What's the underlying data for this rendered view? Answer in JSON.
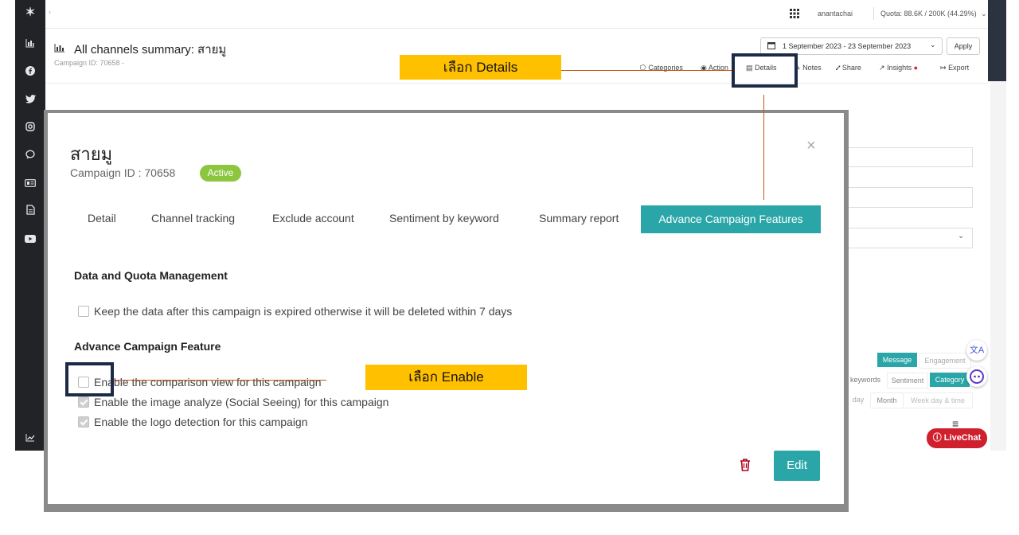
{
  "sidebar": {
    "items": [
      {
        "icon": "logo-icon"
      },
      {
        "icon": "chart-bar-icon"
      },
      {
        "icon": "facebook-icon"
      },
      {
        "icon": "twitter-icon"
      },
      {
        "icon": "instagram-icon"
      },
      {
        "icon": "chat-bubble-icon"
      },
      {
        "icon": "news-icon"
      },
      {
        "icon": "document-icon"
      },
      {
        "icon": "youtube-icon"
      },
      {
        "icon": "trend-icon"
      }
    ]
  },
  "topbar": {
    "username": "anantachai",
    "quota": "Quota: 88.6K / 200K (44.29%)"
  },
  "header": {
    "title": "All channels summary: สายมู",
    "campaign_id": "Campaign ID: 70658 -",
    "date_range": "1 September 2023 - 23 September 2023",
    "apply": "Apply",
    "tools": [
      "Categories",
      "Action",
      "Details",
      "Notes",
      "Share",
      "Insights",
      "Export"
    ]
  },
  "modal": {
    "title": "สายมู",
    "campaign_id": "Campaign ID : 70658",
    "status": "Active",
    "close": "×",
    "tabs": [
      "Detail",
      "Channel tracking",
      "Exclude account",
      "Sentiment by keyword",
      "Summary report",
      "Advance Campaign Features"
    ],
    "section1": "Data and Quota Management",
    "keep_data": "Keep the data after this campaign is expired otherwise it will be deleted within 7 days",
    "section2": "Advance Campaign Feature",
    "options": [
      {
        "label": "Enable the comparison view for this campaign",
        "checked": false
      },
      {
        "label": "Enable the image analyze (Social Seeing) for this campaign",
        "checked": true
      },
      {
        "label": "Enable the logo detection for this campaign",
        "checked": true
      }
    ],
    "edit": "Edit"
  },
  "right_panel": {
    "message": "Message",
    "engagement": "Engagement",
    "keywords": "keywords",
    "sentiment": "Sentiment",
    "category": "Category",
    "day": "day",
    "month": "Month",
    "weekday": "Week day & time",
    "livechat": "LiveChat"
  },
  "annotations": {
    "details_callout": "เลือก Details",
    "enable_callout": "เลือก Enable"
  },
  "colors": {
    "accent_teal": "#2ba6a8",
    "active_green": "#8cc63f",
    "callout_yellow": "#ffc000",
    "highlight_navy": "#1c2a45",
    "connector_orange": "#c55a11",
    "sidebar_dark": "#222326"
  }
}
